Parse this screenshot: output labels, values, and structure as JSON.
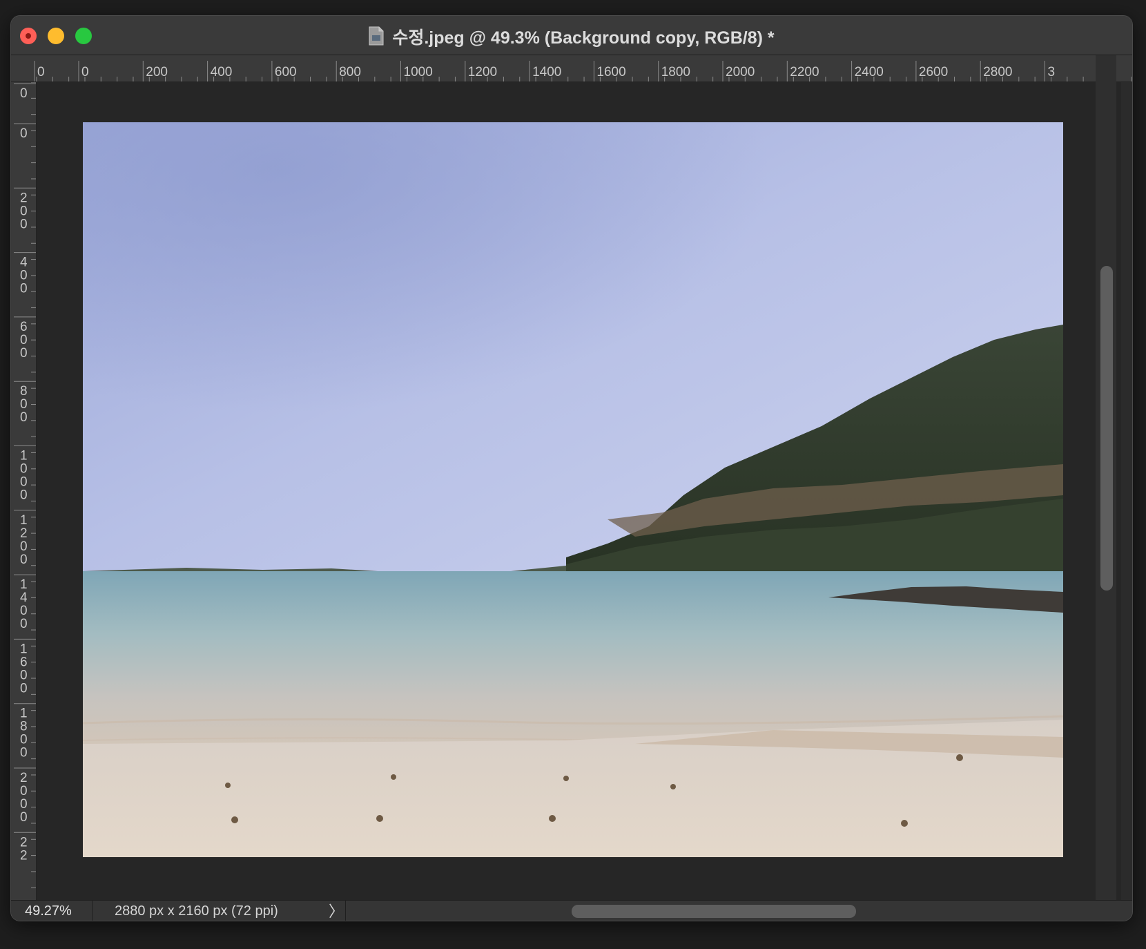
{
  "window": {
    "title": "수정.jpeg @ 49.3% (Background copy, RGB/8) *"
  },
  "ruler_top": {
    "labels": [
      "0",
      "0",
      "200",
      "400",
      "600",
      "800",
      "1000",
      "1200",
      "1400",
      "1600",
      "1800",
      "2000",
      "2200",
      "2400",
      "2600",
      "2800",
      "3"
    ]
  },
  "ruler_left": {
    "labels": [
      "0",
      "0",
      "200",
      "400",
      "600",
      "800",
      "1000",
      "1200",
      "1400",
      "1600",
      "1800",
      "2000",
      "22"
    ]
  },
  "status": {
    "zoom": "49.27%",
    "doc_info": "2880 px x 2160 px (72 ppi)",
    "chevron": "〉"
  },
  "icons": {
    "document": "document-icon",
    "close": "close-icon",
    "minimize": "minimize-icon",
    "maximize": "maximize-icon"
  },
  "colors": {
    "close": "#fe5f57",
    "minimize": "#febc2e",
    "maximize": "#28c840",
    "sky": "#b6bfe3",
    "sea": "#8fb4bd",
    "sand": "#ddd0c4",
    "hill": "#2f3a2c"
  }
}
